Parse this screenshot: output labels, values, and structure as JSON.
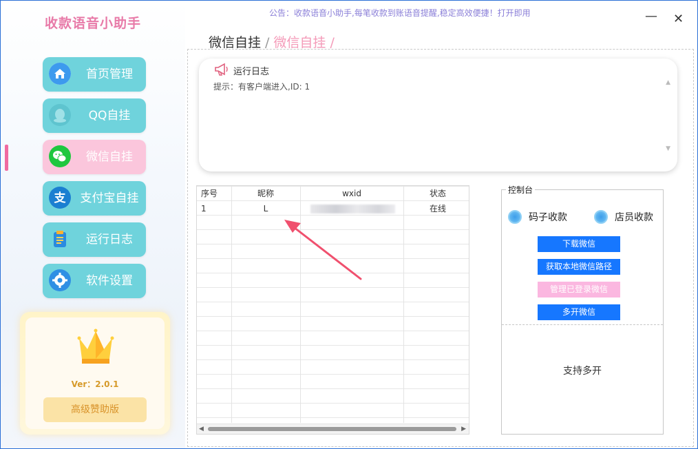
{
  "app": {
    "title": "收款语音小助手"
  },
  "notice": "公告：收款语音小助手,每笔收款到账语音提醒,稳定高效便捷！打开即用",
  "window_controls": {
    "minimize": "—",
    "close": "✕"
  },
  "nav": {
    "items": [
      {
        "label": "首页管理",
        "icon": "home-icon"
      },
      {
        "label": "QQ自挂",
        "icon": "qq-icon"
      },
      {
        "label": "微信自挂",
        "icon": "wechat-icon"
      },
      {
        "label": "支付宝自挂",
        "icon": "alipay-icon"
      },
      {
        "label": "运行日志",
        "icon": "clipboard-icon"
      },
      {
        "label": "软件设置",
        "icon": "gear-icon"
      }
    ],
    "active": "微信自挂"
  },
  "promo": {
    "version": "Ver：2.0.1",
    "button": "高级赞助版",
    "icon": "crown-icon"
  },
  "breadcrumb": {
    "parent": "微信自挂",
    "current": "微信自挂",
    "separator": "/"
  },
  "log": {
    "title": "运行日志",
    "icon": "megaphone-icon",
    "line": "提示：有客户端进入,ID: 1"
  },
  "table": {
    "columns": [
      "序号",
      "昵称",
      "wxid",
      "状态"
    ],
    "rows": [
      {
        "index": "1",
        "nickname": "L",
        "wxid": "",
        "status": "在线"
      }
    ]
  },
  "console": {
    "title": "控制台",
    "radio_1": "码子收款",
    "radio_2": "店员收款",
    "buttons": {
      "download": "下载微信",
      "get_path": "获取本地微信路径",
      "manage": "管理已登录微信",
      "multi_open": "多开微信"
    },
    "multi_support": "支持多开"
  },
  "colors": {
    "nav_button": "#6fd3dc",
    "nav_active": "#fbc6dc",
    "title_pink": "#e87aa8",
    "primary_button": "#1677ff",
    "disabled_button": "#fbb7e0",
    "annotation_arrow": "#f0506e"
  }
}
